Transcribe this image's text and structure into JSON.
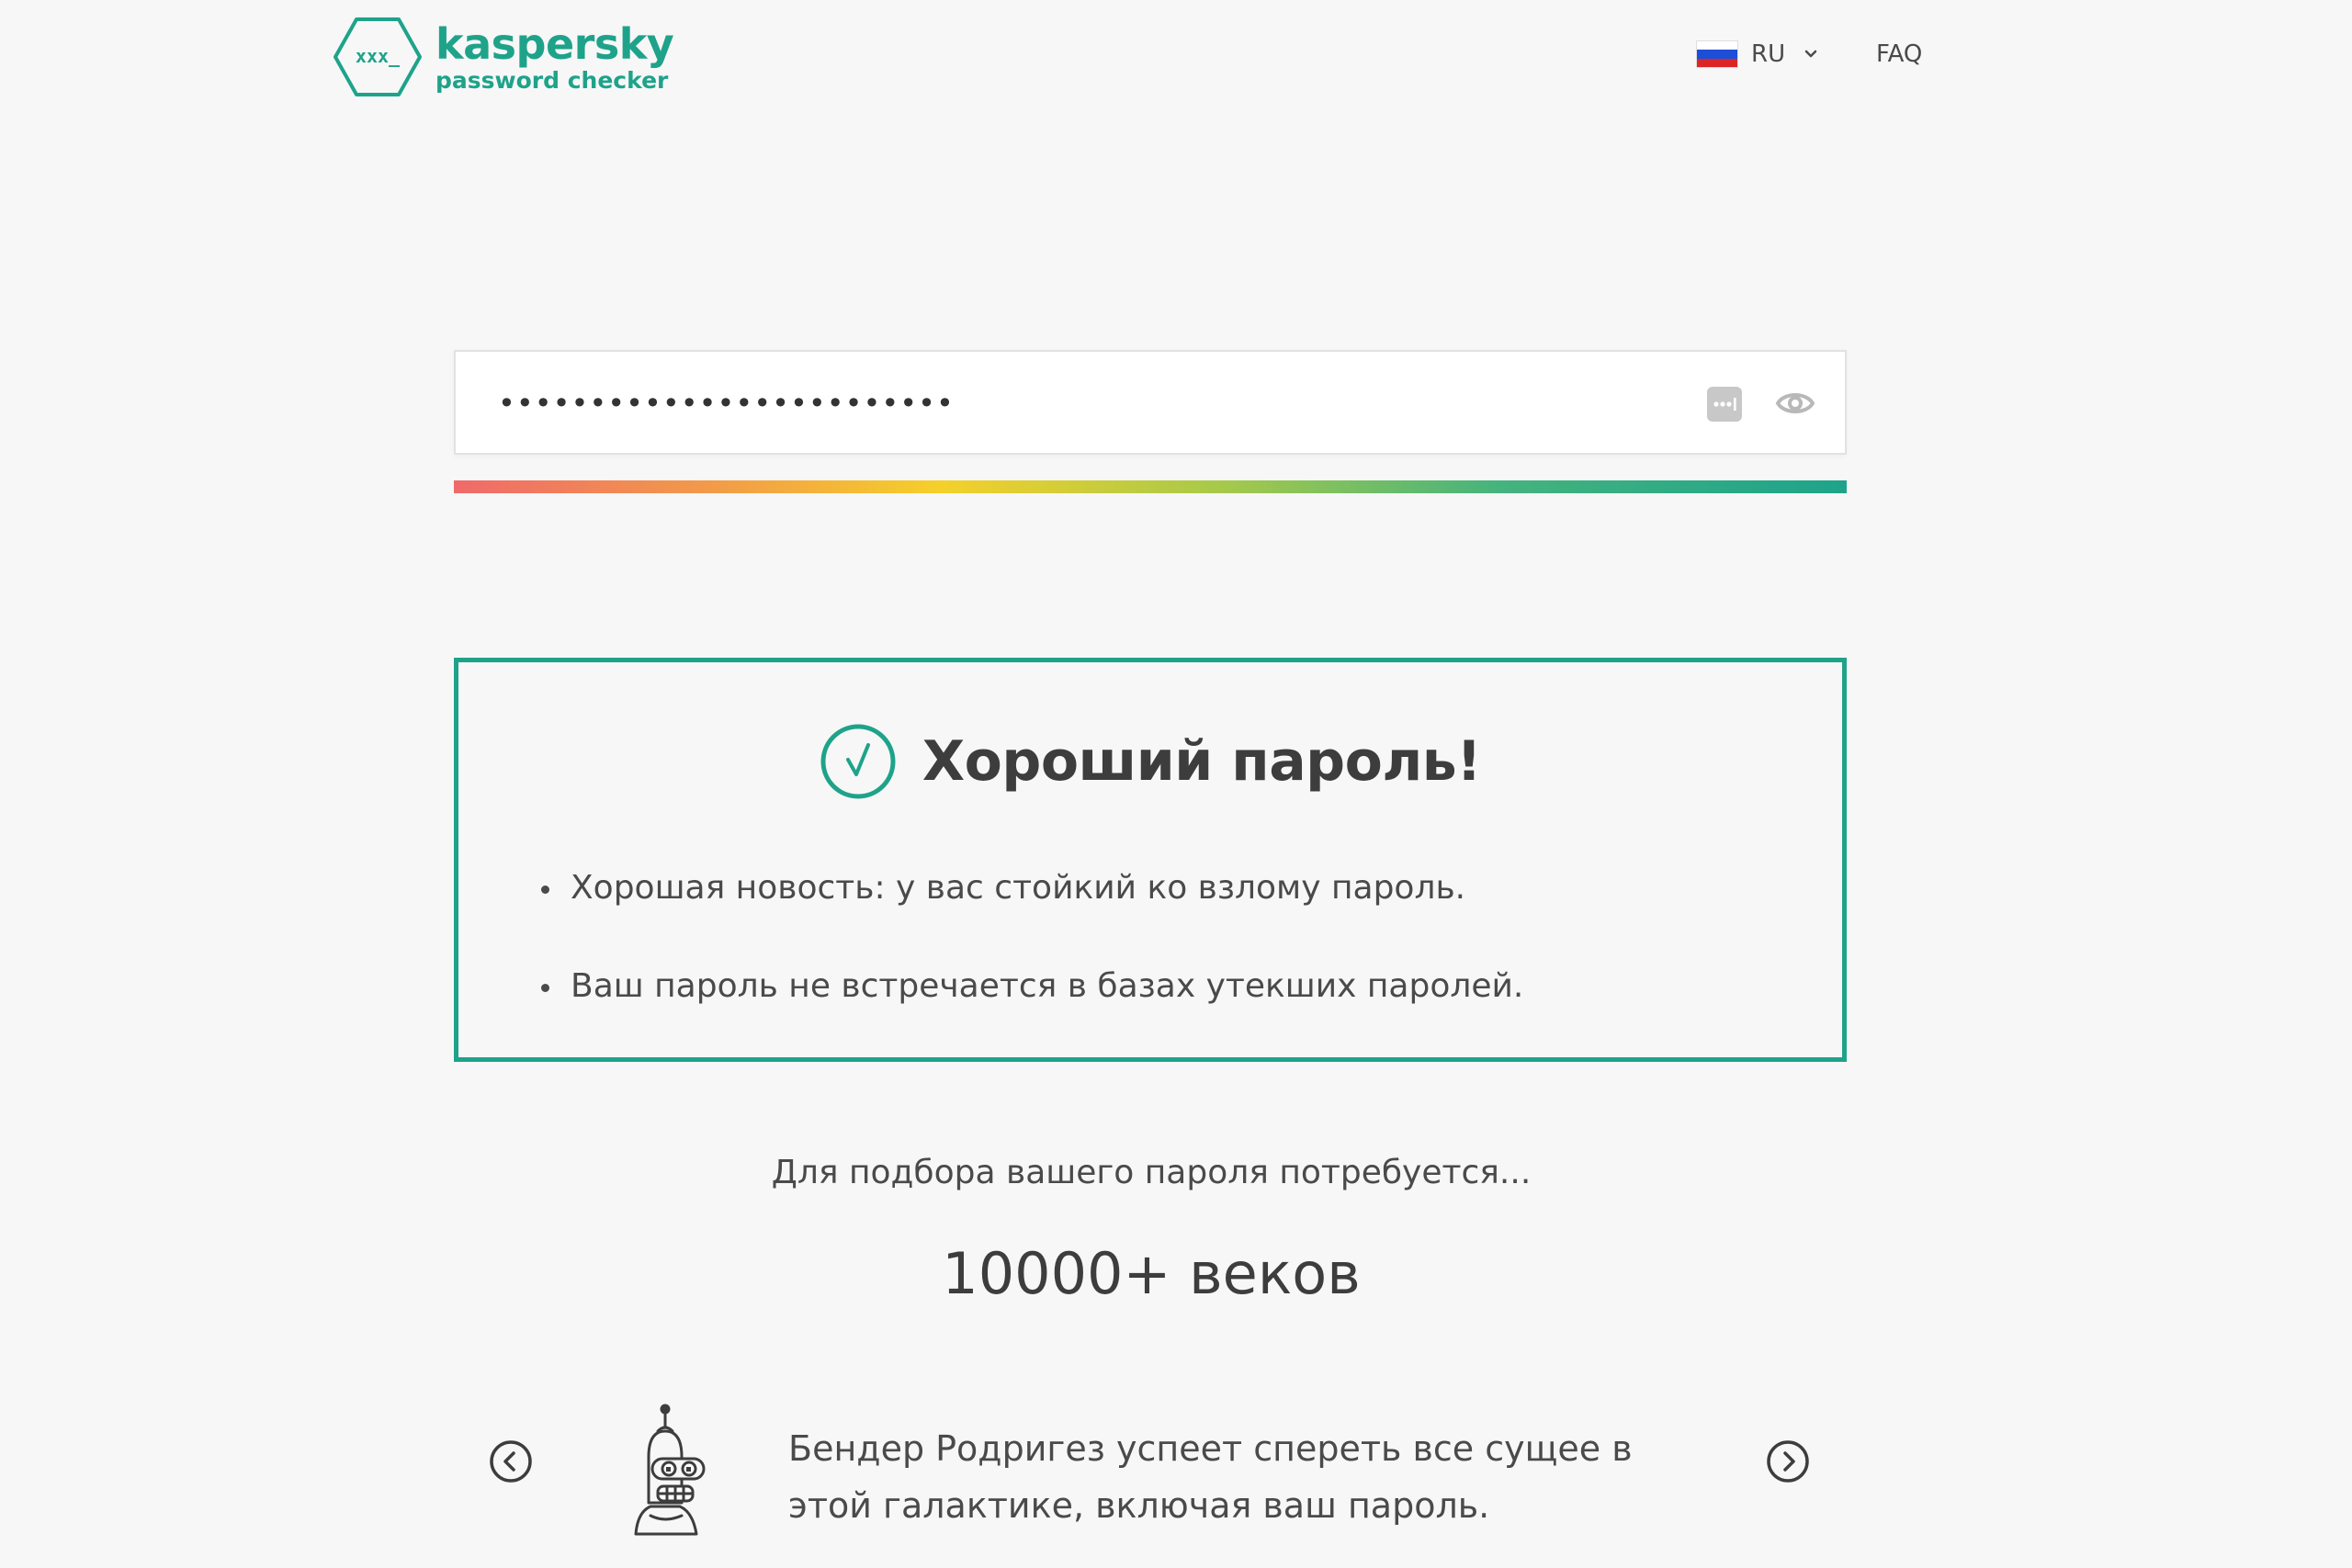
{
  "header": {
    "brand": "kaspersky",
    "product": "password checker",
    "logo_mark_text": "xxx_",
    "language": "RU",
    "faq_label": "FAQ"
  },
  "password": {
    "masked_value": "•••••••••••••••••••••••••",
    "strength_fraction": 1.0
  },
  "result": {
    "title": "Хороший пароль!",
    "points": [
      "Хорошая новость: у вас стойкий ко взлому пароль.",
      "Ваш пароль не встречается в базах утекших паролей."
    ]
  },
  "crack_time": {
    "label": "Для подбора вашего пароля потребуется...",
    "value": "10000+ веков"
  },
  "carousel": {
    "text": "Бендер Родригез успеет спереть все сущее в этой галактике, включая ваш пароль."
  },
  "colors": {
    "accent": "#1ea38a",
    "text": "#4a4a4a",
    "background": "#f7f7f7"
  },
  "icons": {
    "logo": "hexagon-logo-icon",
    "flag": "russia-flag-icon",
    "generate": "password-generator-icon",
    "visibility": "eye-icon",
    "success": "check-circle-icon",
    "prev": "chevron-left-circle-icon",
    "next": "chevron-right-circle-icon",
    "illustration": "bender-robot-icon"
  }
}
